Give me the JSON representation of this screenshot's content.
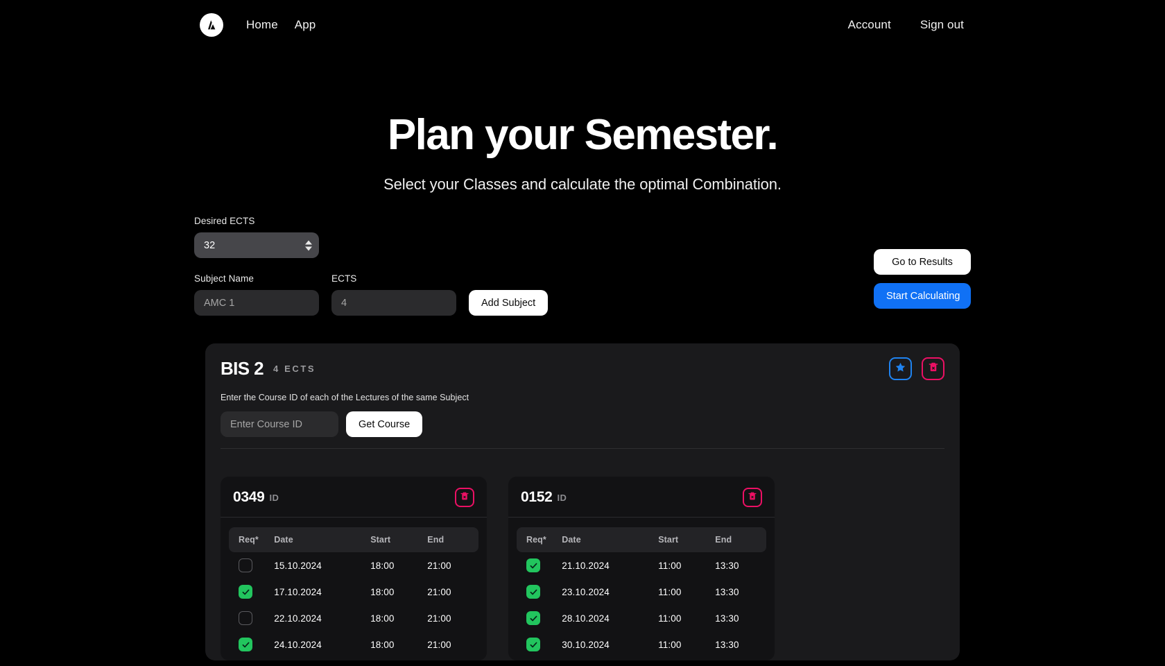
{
  "nav": {
    "logo_icon": "triangle-a-logo-icon",
    "links": [
      {
        "label": "Home"
      },
      {
        "label": "App"
      }
    ],
    "right_links": [
      {
        "label": "Account"
      },
      {
        "label": "Sign out"
      }
    ]
  },
  "hero": {
    "title": "Plan your Semester.",
    "subtitle": "Select your Classes and calculate the optimal Combination."
  },
  "form": {
    "desired_ects_label": "Desired ECTS",
    "desired_ects_value": "32",
    "subject_name_label": "Subject Name",
    "subject_name_placeholder": "AMC 1",
    "subject_name_value": "",
    "ects_label": "ECTS",
    "ects_placeholder": "4",
    "ects_value": "",
    "add_subject_label": "Add Subject",
    "go_to_results_label": "Go to Results",
    "start_calculating_label": "Start Calculating"
  },
  "subject": {
    "name": "BIS 2",
    "ects": "4 ECTS",
    "star_icon": "star-icon",
    "delete_icon": "trash-delete-icon",
    "hint": "Enter the Course ID of each of the Lectures of the same Subject",
    "course_id_placeholder": "Enter Course ID",
    "course_id_value": "",
    "get_course_label": "Get Course"
  },
  "table_headers": [
    "Req*",
    "Date",
    "Start",
    "End"
  ],
  "courses": [
    {
      "id": "0349",
      "id_suffix": "ID",
      "delete_icon": "trash-delete-icon",
      "rows": [
        {
          "req": false,
          "date": "15.10.2024",
          "start": "18:00",
          "end": "21:00"
        },
        {
          "req": true,
          "date": "17.10.2024",
          "start": "18:00",
          "end": "21:00"
        },
        {
          "req": false,
          "date": "22.10.2024",
          "start": "18:00",
          "end": "21:00"
        },
        {
          "req": true,
          "date": "24.10.2024",
          "start": "18:00",
          "end": "21:00"
        }
      ]
    },
    {
      "id": "0152",
      "id_suffix": "ID",
      "delete_icon": "trash-delete-icon",
      "rows": [
        {
          "req": true,
          "date": "21.10.2024",
          "start": "11:00",
          "end": "13:30"
        },
        {
          "req": true,
          "date": "23.10.2024",
          "start": "11:00",
          "end": "13:30"
        },
        {
          "req": true,
          "date": "28.10.2024",
          "start": "11:00",
          "end": "13:30"
        },
        {
          "req": true,
          "date": "30.10.2024",
          "start": "11:00",
          "end": "13:30"
        }
      ]
    }
  ],
  "colors": {
    "background": "#000000",
    "card": "#1a1a1c",
    "inner_card": "#121214",
    "accent_blue": "#1071f5",
    "accent_pink": "#ec1064",
    "accent_green": "#22c55e",
    "input": "#2b2b2d"
  }
}
